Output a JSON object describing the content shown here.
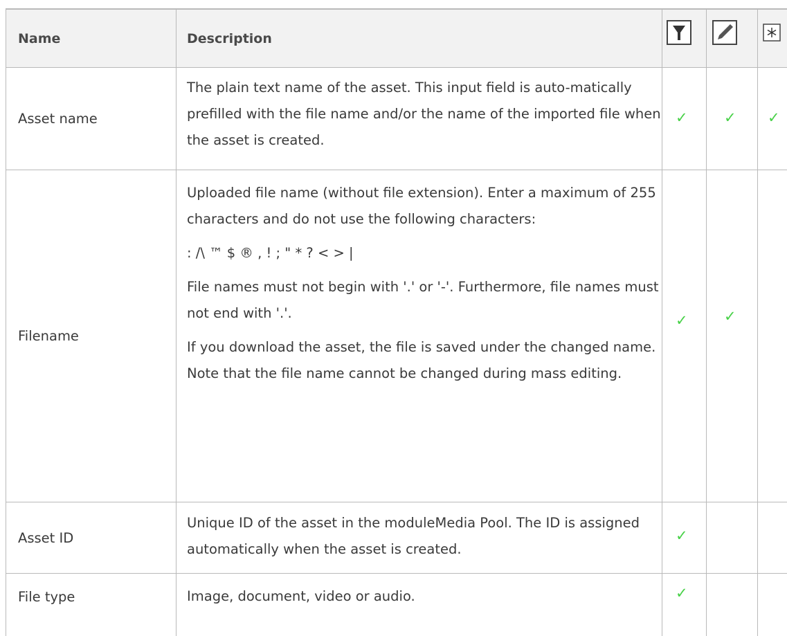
{
  "header": {
    "name": "Name",
    "description": "Description",
    "icons": [
      "filter-icon",
      "edit-icon",
      "asterisk-icon"
    ]
  },
  "rows": [
    {
      "name": "Asset name",
      "description": [
        "The plain text name of the asset. This input field is auto-matically prefilled with the file name and/or the name of the imported file when the asset is created."
      ],
      "checks": [
        true,
        true,
        true
      ]
    },
    {
      "name": "Filename",
      "description": [
        "Uploaded file name (without file extension). Enter a maximum of 255 characters and do not use the following characters:",
        ": /\\ ™ $ ® , ! ; \" * ? < > |",
        "File names must not begin with '.' or '-'. Furthermore, file names must not end with '.'.",
        "If you download the asset, the file is saved under the changed name. Note that the file name cannot be changed during mass editing."
      ],
      "checks": [
        true,
        true,
        false
      ]
    },
    {
      "name": "Asset ID",
      "description": [
        "Unique ID of the asset in the moduleMedia Pool. The ID is assigned automatically when the asset is created."
      ],
      "checks": [
        true,
        false,
        false
      ]
    },
    {
      "name": "File type",
      "description": [
        "Image, document, video or audio."
      ],
      "checks": [
        true,
        false,
        false
      ]
    }
  ],
  "check_symbol": "✓",
  "colors": {
    "check": "#47d147",
    "border": "#b9b9b9",
    "header_bg": "#f2f2f2"
  }
}
